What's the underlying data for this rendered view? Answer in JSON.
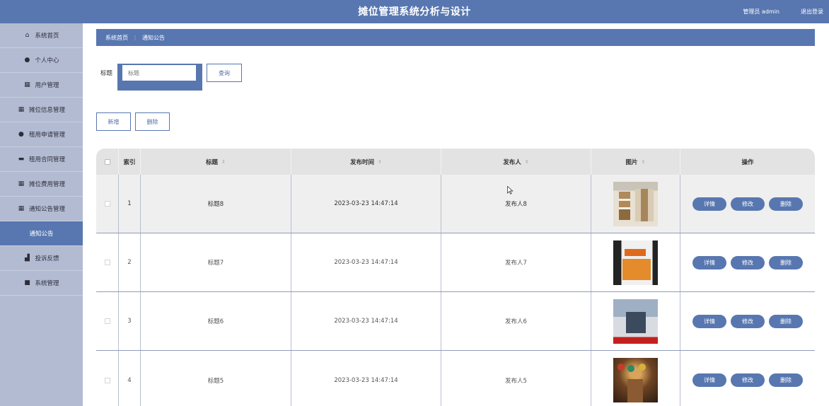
{
  "header": {
    "title": "摊位管理系统分析与设计",
    "user": "管理员 admin",
    "logout": "退出登录"
  },
  "sidebar": {
    "items": [
      {
        "label": "系统首页",
        "icon": "home-icon"
      },
      {
        "label": "个人中心",
        "icon": "person-icon"
      },
      {
        "label": "用户管理",
        "icon": "grid-icon"
      },
      {
        "label": "摊位信息管理",
        "icon": "grid-icon"
      },
      {
        "label": "租用申请管理",
        "icon": "person-icon"
      },
      {
        "label": "租用合同管理",
        "icon": "card-icon"
      },
      {
        "label": "摊位费用管理",
        "icon": "grid-icon"
      },
      {
        "label": "通知公告管理",
        "icon": "grid-icon"
      },
      {
        "label": "通知公告",
        "icon": "",
        "active": true
      },
      {
        "label": "投诉反馈",
        "icon": "chart-icon"
      },
      {
        "label": "系统管理",
        "icon": "video-icon"
      }
    ]
  },
  "breadcrumb": {
    "home": "系统首页",
    "separator": "⋮",
    "current": "通知公告"
  },
  "search": {
    "label": "标题",
    "placeholder": "标题",
    "button": "查询"
  },
  "toolbar": {
    "add": "新增",
    "delete": "删除"
  },
  "table": {
    "columns": [
      "索引",
      "标题",
      "发布时间",
      "发布人",
      "图片",
      "操作"
    ],
    "actions": {
      "detail": "详情",
      "edit": "修改",
      "delete": "删除"
    },
    "rows": [
      {
        "index": "1",
        "title": "标题8",
        "time": "2023-03-23 14:47:14",
        "publisher": "发布人8",
        "image": "shop-shelves-photo"
      },
      {
        "index": "2",
        "title": "标题7",
        "time": "2023-03-23 14:47:14",
        "publisher": "发布人7",
        "image": "orange-kiosk-photo"
      },
      {
        "index": "3",
        "title": "标题6",
        "time": "2023-03-23 14:47:14",
        "publisher": "发布人6",
        "image": "storefront-photo"
      },
      {
        "index": "4",
        "title": "标题5",
        "time": "2023-03-23 14:47:14",
        "publisher": "发布人5",
        "image": "restaurant-interior-photo"
      }
    ]
  },
  "colors": {
    "primary": "#5877b0",
    "sidebar": "#b3bbd2",
    "table_header": "#e3e3e3"
  }
}
